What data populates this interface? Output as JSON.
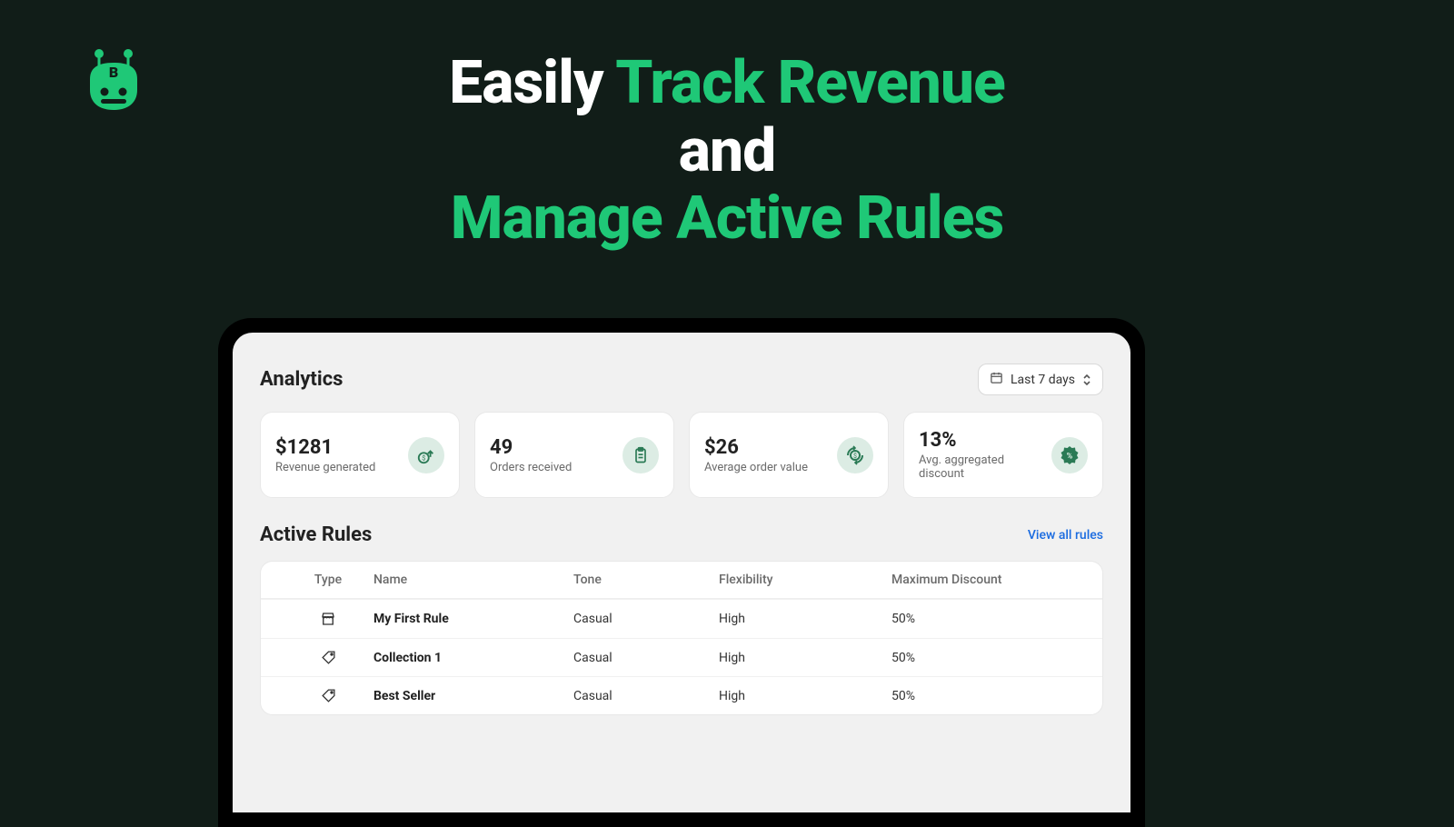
{
  "headline": {
    "part1": "Easily ",
    "part2": "Track Revenue",
    "part3": "and",
    "part4": "Manage Active Rules"
  },
  "analytics": {
    "title": "Analytics",
    "date_range": "Last 7 days",
    "cards": [
      {
        "value": "$1281",
        "label": "Revenue generated",
        "icon": "revenue-icon"
      },
      {
        "value": "49",
        "label": "Orders received",
        "icon": "orders-icon"
      },
      {
        "value": "$26",
        "label": "Average order value",
        "icon": "aov-icon"
      },
      {
        "value": "13%",
        "label": "Avg. aggregated discount",
        "icon": "discount-icon"
      }
    ]
  },
  "rules": {
    "title": "Active Rules",
    "view_all": "View all rules",
    "columns": {
      "type": "Type",
      "name": "Name",
      "tone": "Tone",
      "flexibility": "Flexibility",
      "max_discount": "Maximum Discount"
    },
    "rows": [
      {
        "type_icon": "store-icon",
        "name": "My First Rule",
        "tone": "Casual",
        "flexibility": "High",
        "max_discount": "50%"
      },
      {
        "type_icon": "tag-icon",
        "name": "Collection 1",
        "tone": "Casual",
        "flexibility": "High",
        "max_discount": "50%"
      },
      {
        "type_icon": "tag-icon",
        "name": "Best Seller",
        "tone": "Casual",
        "flexibility": "High",
        "max_discount": "50%"
      }
    ]
  }
}
